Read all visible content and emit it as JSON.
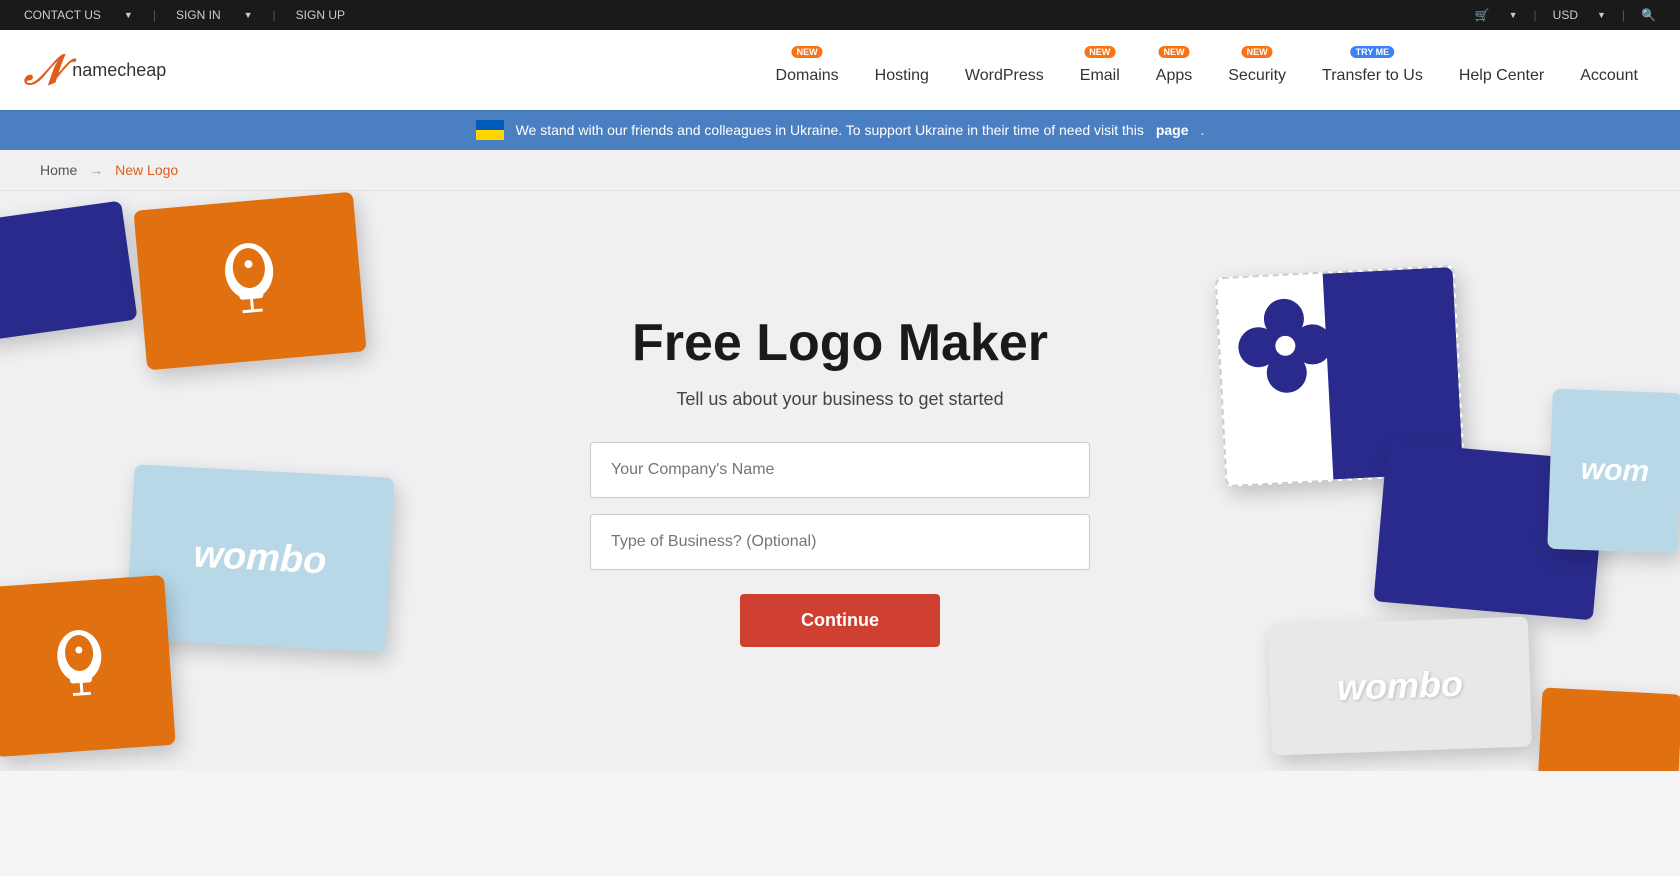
{
  "topbar": {
    "contact_us": "CONTACT US",
    "sign_in": "SIGN IN",
    "sign_up": "SIGN UP",
    "cart_label": "Cart",
    "currency": "USD"
  },
  "nav": {
    "logo_text": "namecheap",
    "items": [
      {
        "id": "domains",
        "label": "Domains",
        "badge": "NEW",
        "badge_type": "new"
      },
      {
        "id": "hosting",
        "label": "Hosting",
        "badge": null
      },
      {
        "id": "wordpress",
        "label": "WordPress",
        "badge": null
      },
      {
        "id": "email",
        "label": "Email",
        "badge": "NEW",
        "badge_type": "new"
      },
      {
        "id": "apps",
        "label": "Apps",
        "badge": "NEW",
        "badge_type": "new"
      },
      {
        "id": "security",
        "label": "Security",
        "badge": "NEW",
        "badge_type": "new"
      },
      {
        "id": "transfer",
        "label": "Transfer to Us",
        "badge": "TRY ME",
        "badge_type": "tryme"
      },
      {
        "id": "helpcenter",
        "label": "Help Center",
        "badge": null
      },
      {
        "id": "account",
        "label": "Account",
        "badge": null
      }
    ]
  },
  "banner": {
    "text": "We stand with our friends and colleagues in Ukraine. To support Ukraine in their time of need visit this",
    "link_text": "page"
  },
  "breadcrumb": {
    "home": "Home",
    "arrow": "→",
    "current": "New Logo"
  },
  "hero": {
    "title": "Free Logo Maker",
    "subtitle": "Tell us about your business to get started",
    "company_placeholder": "Your Company's Name",
    "business_placeholder": "Type of Business? (Optional)",
    "continue_button": "Continue"
  },
  "colors": {
    "orange": "#e07010",
    "navy": "#2a2a8c",
    "light_blue": "#b8d8e8",
    "red_btn": "#d04030"
  }
}
